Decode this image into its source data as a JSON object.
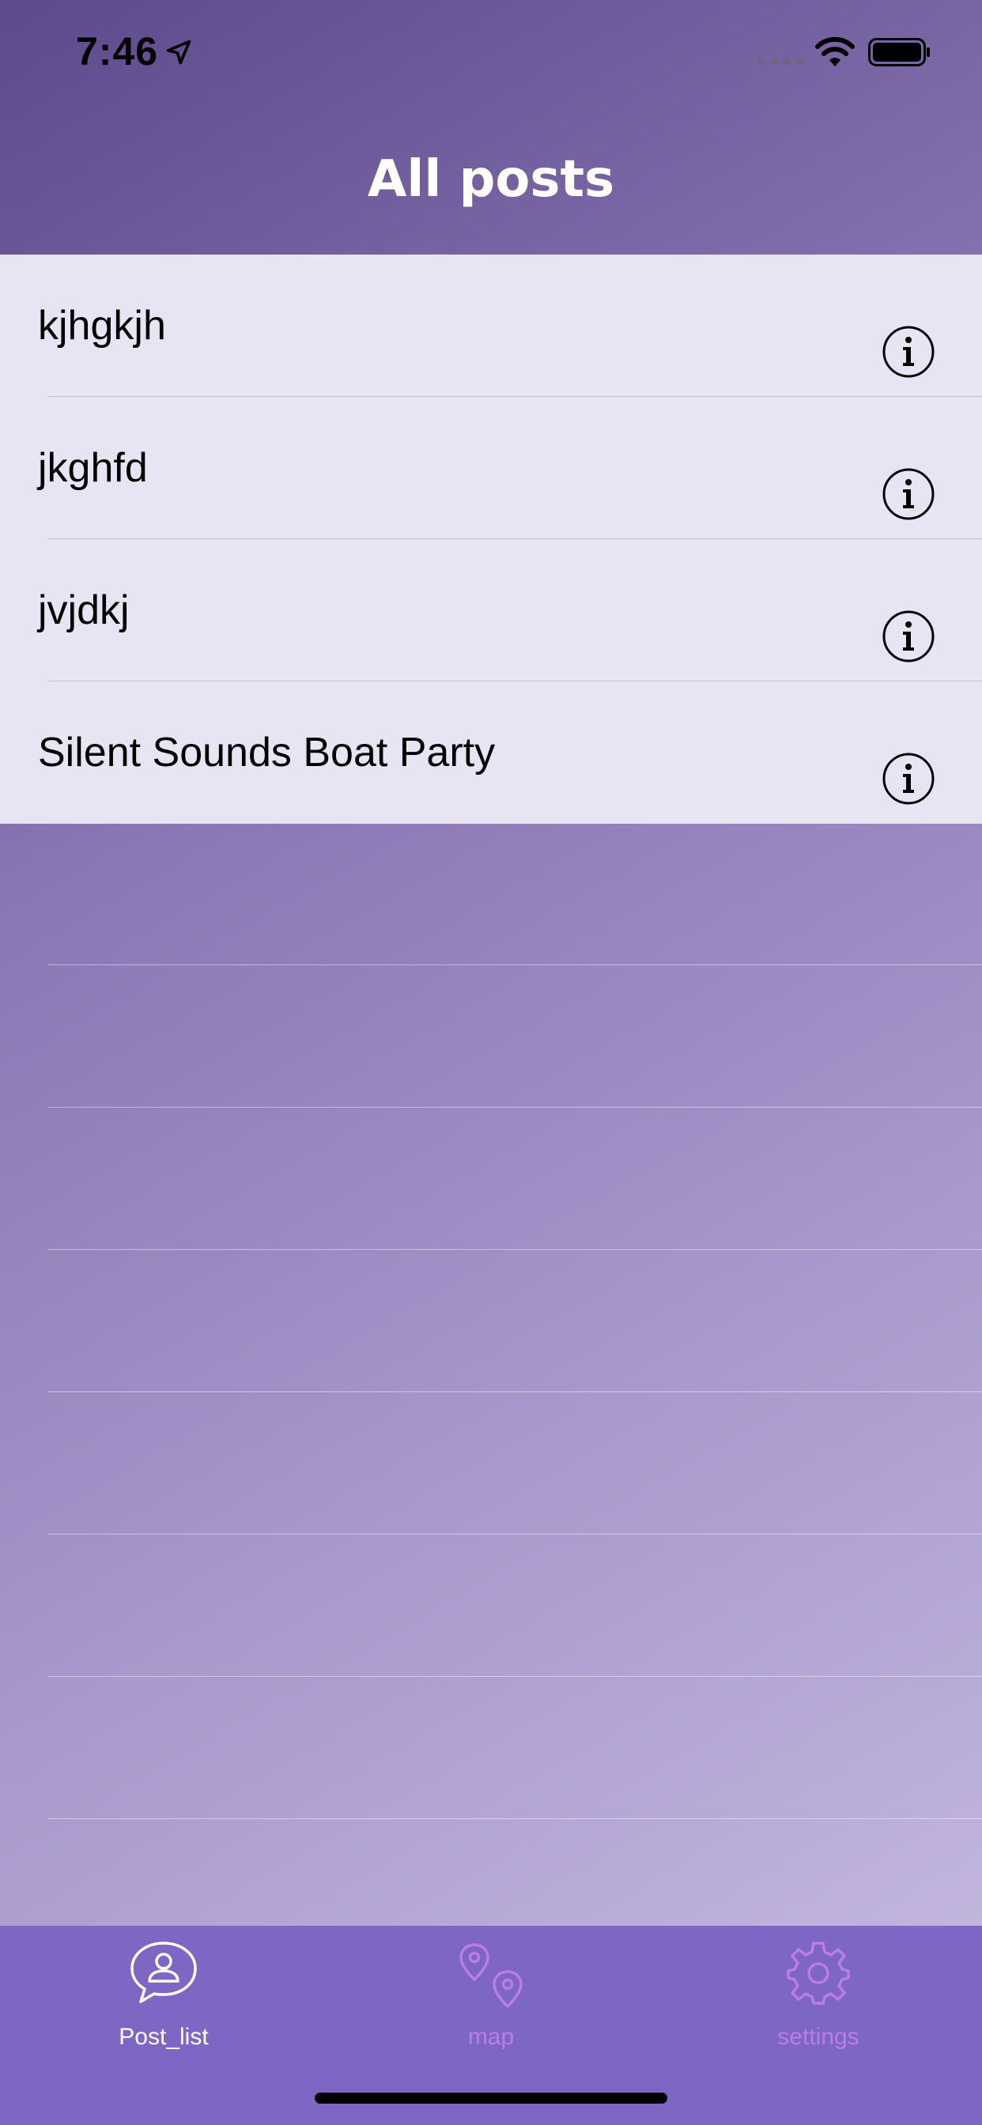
{
  "status_bar": {
    "time": "7:46",
    "icons": [
      "location-arrow-icon",
      "cellular-signal-icon",
      "wifi-icon",
      "battery-icon"
    ]
  },
  "navigation": {
    "title": "All posts"
  },
  "posts": [
    {
      "title": "kjhgkjh",
      "accessory_icon": "info-icon"
    },
    {
      "title": "jkghfd",
      "accessory_icon": "info-icon"
    },
    {
      "title": "jvjdkj",
      "accessory_icon": "info-icon"
    },
    {
      "title": "Silent Sounds Boat Party",
      "accessory_icon": "info-icon"
    }
  ],
  "tab_bar": {
    "tabs": [
      {
        "label": "Post_list",
        "icon": "person-chat-bubble-icon",
        "selected": true
      },
      {
        "label": "map",
        "icon": "map-pins-icon",
        "selected": false
      },
      {
        "label": "settings",
        "icon": "gear-icon",
        "selected": false
      }
    ]
  },
  "colors": {
    "background_gradient_start": "#5d4a8c",
    "background_gradient_end": "#c8bce2",
    "row_background": "#e8e4f4",
    "tab_bar_background": "#7e66c4",
    "tab_active": "#ffffff",
    "tab_inactive": "#b87ee6"
  }
}
